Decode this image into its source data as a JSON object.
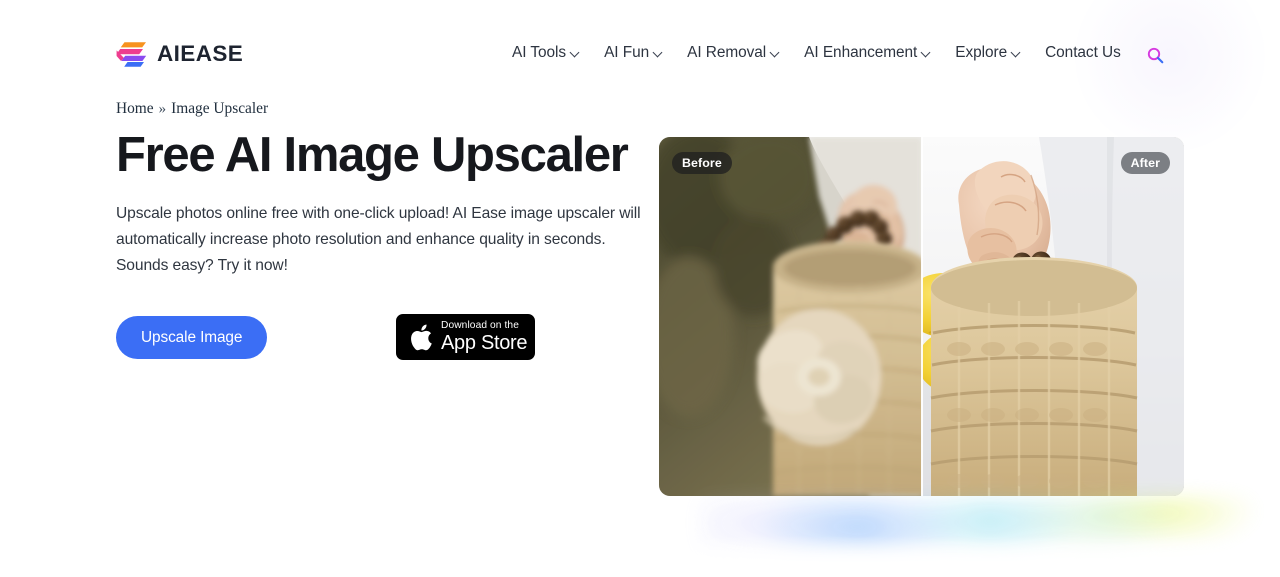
{
  "brand": {
    "name": "AIEASE",
    "logo_icon": "aiease-stacked-arrows-logo"
  },
  "nav": {
    "items": [
      {
        "label": "AI Tools",
        "has_dropdown": true,
        "icon": "chevron-down-icon"
      },
      {
        "label": "AI Fun",
        "has_dropdown": true,
        "icon": "chevron-down-icon"
      },
      {
        "label": "AI Removal",
        "has_dropdown": true,
        "icon": "chevron-down-icon"
      },
      {
        "label": "AI Enhancement",
        "has_dropdown": true,
        "icon": "chevron-down-icon"
      },
      {
        "label": "Explore",
        "has_dropdown": true,
        "icon": "chevron-down-icon"
      },
      {
        "label": "Contact Us",
        "has_dropdown": false,
        "icon": ""
      }
    ],
    "search_icon": "search-icon"
  },
  "breadcrumb": {
    "home": "Home",
    "separator": "»",
    "current": "Image Upscaler"
  },
  "hero": {
    "headline": "Free AI Image Upscaler",
    "subtext": "Upscale photos online free with one-click upload! AI Ease image upscaler will automatically increase photo resolution and enhance quality in seconds. Sounds easy? Try it now!",
    "cta_label": "Upscale Image",
    "appstore": {
      "small_text": "Download on the",
      "big_text": "App Store",
      "icon": "apple-logo-icon"
    }
  },
  "comparison": {
    "before_label": "Before",
    "after_label": "After",
    "subject": "hands holding a woven straw basket filled with lemons",
    "divider_position_percent": 50
  },
  "colors": {
    "primary_button": "#3b6ef5",
    "headline_text": "#16181d",
    "body_text": "#2f3640",
    "nav_text": "#2d3440",
    "breadcrumb_text": "#22303f",
    "appstore_badge_bg": "#000000",
    "tag_before_bg": "rgba(32,32,32,0.78)",
    "tag_after_bg": "rgba(92,96,101,0.78)",
    "logo_orange": "#f7921e",
    "logo_pink": "#ee3d8f",
    "logo_purple": "#8a4bf0",
    "logo_blue": "#3b6ef5",
    "search_icon_magenta": "#d63ae0",
    "search_icon_blue": "#3b6ef5",
    "page_background": "#ffffff"
  }
}
